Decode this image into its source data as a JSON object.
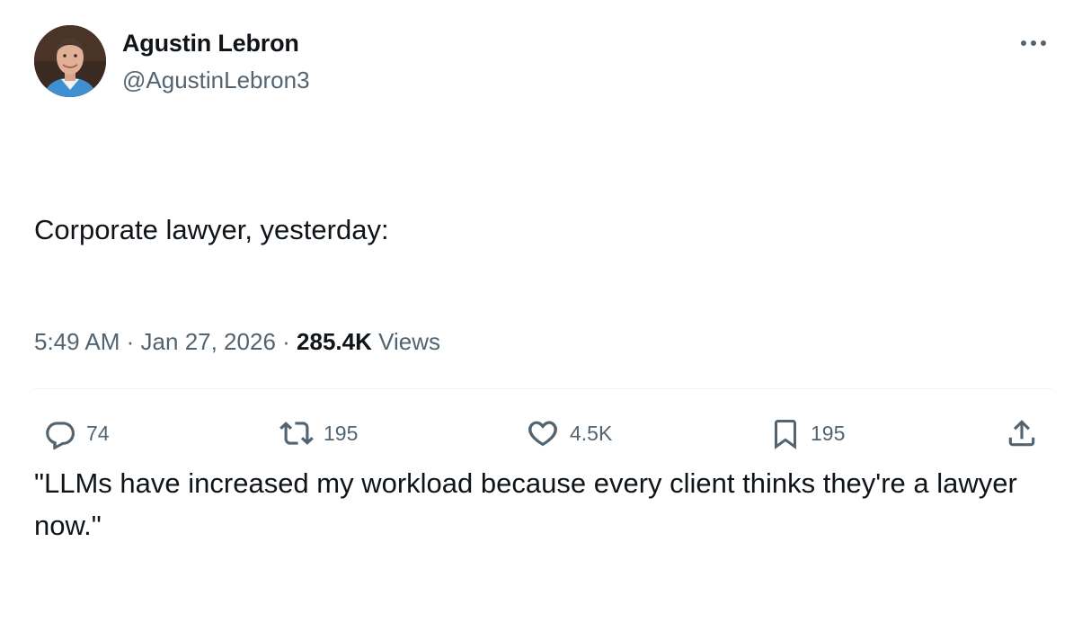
{
  "author": {
    "name": "Agustin Lebron",
    "handle": "@AgustinLebron3"
  },
  "tweet": {
    "line1": "Corporate lawyer, yesterday:",
    "line2": "\"LLMs have increased my workload because every client thinks they're a lawyer now.\""
  },
  "meta": {
    "time": "5:49 AM",
    "separator": "·",
    "date": "Jan 27, 2026",
    "views_count": "285.4K",
    "views_label": "Views"
  },
  "actions": {
    "replies": "74",
    "retweets": "195",
    "likes": "4.5K",
    "bookmarks": "195"
  },
  "colors": {
    "text": "#0f1419",
    "secondary": "#536471",
    "divider": "#eff3f4"
  }
}
